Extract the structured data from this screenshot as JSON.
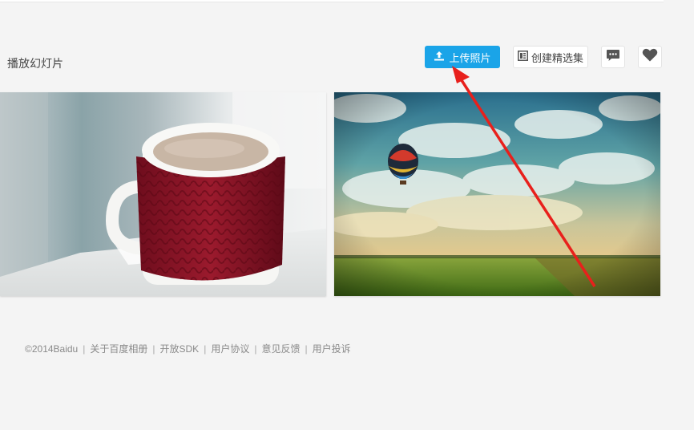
{
  "toolbar": {
    "slideshow_label": "播放幻灯片",
    "upload_label": "上传照片",
    "create_collection_label": "创建精选集",
    "comment_icon": "comment-icon",
    "like_icon": "heart-icon",
    "accent_color": "#1aa4e8"
  },
  "photos": [
    {
      "subject": "red knitted sweater mug of coffee"
    },
    {
      "subject": "hot air balloon over green field and cloudy sky"
    }
  ],
  "annotation": {
    "arrow_color": "#e8201c"
  },
  "footer": {
    "copyright": "©2014Baidu",
    "links": [
      "关于百度相册",
      "开放SDK",
      "用户协议",
      "意见反馈",
      "用户投诉"
    ]
  }
}
